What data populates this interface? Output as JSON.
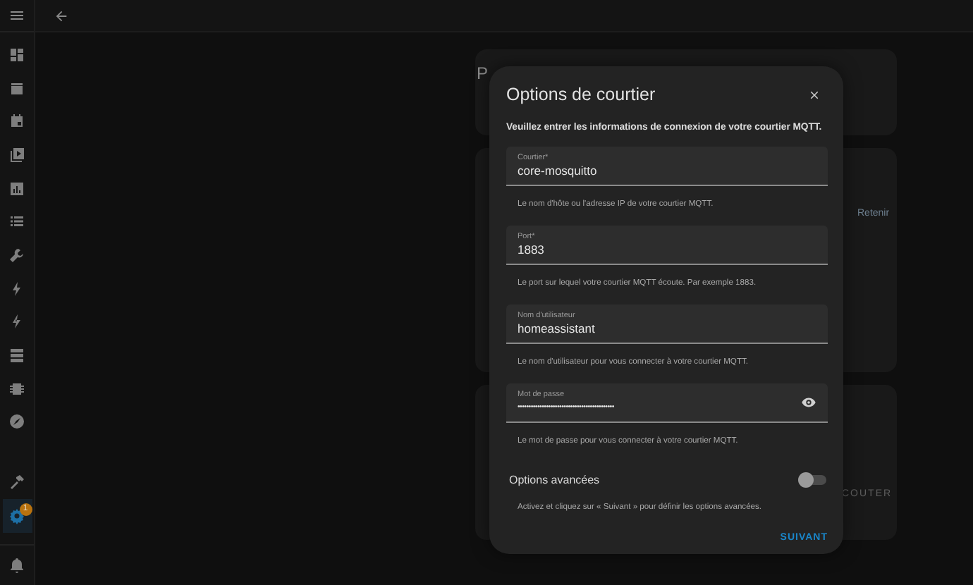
{
  "sidebar": {
    "items": [
      {
        "selected": false
      },
      {
        "selected": false
      },
      {
        "selected": false
      },
      {
        "selected": false
      },
      {
        "selected": false
      },
      {
        "selected": false
      },
      {
        "selected": false
      },
      {
        "selected": false
      },
      {
        "selected": false
      },
      {
        "selected": false
      },
      {
        "selected": false
      },
      {
        "selected": false
      }
    ],
    "bottom_items": [
      {
        "selected": false
      },
      {
        "selected": true,
        "badge": "1"
      }
    ]
  },
  "page": {
    "cards": [
      {
        "title": "P"
      },
      {
        "action": "Retenir"
      },
      {
        "action": "COUTER"
      }
    ]
  },
  "dialog": {
    "title": "Options de courtier",
    "intro": "Veuillez entrer les informations de connexion de votre courtier MQTT.",
    "fields": [
      {
        "kind": "text",
        "label": "Courtier*",
        "value": "core-mosquitto",
        "helper": "Le nom d'hôte ou l'adresse IP de votre courtier MQTT."
      },
      {
        "kind": "text",
        "label": "Port*",
        "value": "1883",
        "helper": "Le port sur lequel votre courtier MQTT écoute. Par exemple 1883."
      },
      {
        "kind": "text",
        "label": "Nom d'utilisateur",
        "value": "homeassistant",
        "helper": "Le nom d'utilisateur pour vous connecter à votre courtier MQTT."
      },
      {
        "kind": "password",
        "label": "Mot de passe",
        "value": "••••••••••••••••••••••••••••••••••••••••••••",
        "helper": "Le mot de passe pour vous connecter à votre courtier MQTT."
      }
    ],
    "advanced": {
      "label": "Options avancées",
      "on": false,
      "helper": "Activez et cliquez sur « Suivant » pour définir les options avancées."
    },
    "button": "SUIVANT"
  }
}
